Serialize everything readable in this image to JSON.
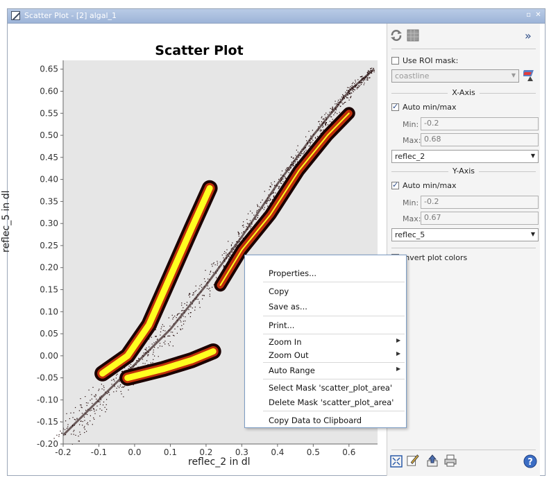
{
  "window": {
    "title": "Scatter Plot - [2] algal_1",
    "buttons": [
      "▫",
      "✕"
    ]
  },
  "plot": {
    "title": "Scatter Plot",
    "xlabel": "reflec_2 in dl",
    "ylabel": "reflec_5 in dl"
  },
  "chart_data": {
    "type": "scatter",
    "title": "Scatter Plot",
    "xlabel": "reflec_2 in dl",
    "ylabel": "reflec_5 in dl",
    "xlim": [
      -0.2,
      0.68
    ],
    "ylim": [
      -0.2,
      0.67
    ],
    "xticks": [
      "-0.2",
      "-0.1",
      "0.0",
      "0.1",
      "0.2",
      "0.3",
      "0.4",
      "0.5",
      "0.6"
    ],
    "yticks": [
      "-0.20",
      "-0.15",
      "-0.10",
      "-0.05",
      "0.00",
      "0.05",
      "0.10",
      "0.15",
      "0.20",
      "0.25",
      "0.30",
      "0.35",
      "0.40",
      "0.45",
      "0.50",
      "0.55",
      "0.60",
      "0.65"
    ],
    "grid": false,
    "density_bands": [
      {
        "points": [
          [
            -0.2,
            -0.18
          ],
          [
            -0.1,
            -0.1
          ],
          [
            0.0,
            -0.02
          ],
          [
            0.1,
            0.06
          ],
          [
            0.2,
            0.16
          ],
          [
            0.3,
            0.27
          ],
          [
            0.4,
            0.39
          ],
          [
            0.5,
            0.5
          ],
          [
            0.6,
            0.6
          ],
          [
            0.67,
            0.65
          ]
        ],
        "density": "sparse"
      },
      {
        "points": [
          [
            -0.09,
            -0.04
          ],
          [
            -0.02,
            0.0
          ],
          [
            0.04,
            0.07
          ],
          [
            0.1,
            0.18
          ],
          [
            0.16,
            0.29
          ],
          [
            0.21,
            0.38
          ]
        ],
        "density": "high"
      },
      {
        "points": [
          [
            -0.02,
            -0.05
          ],
          [
            0.08,
            -0.03
          ],
          [
            0.16,
            -0.01
          ],
          [
            0.22,
            0.01
          ]
        ],
        "density": "high"
      },
      {
        "points": [
          [
            0.24,
            0.16
          ],
          [
            0.3,
            0.24
          ],
          [
            0.38,
            0.32
          ],
          [
            0.46,
            0.42
          ],
          [
            0.54,
            0.5
          ],
          [
            0.6,
            0.55
          ]
        ],
        "density": "medium"
      }
    ]
  },
  "sidebar": {
    "use_roi_label": "Use ROI mask:",
    "roi_value": "coastline",
    "x_axis": {
      "title": "X-Axis",
      "auto_label": "Auto min/max",
      "min_label": "Min:",
      "min_value": "-0.2",
      "max_label": "Max:",
      "max_value": "0.68",
      "band": "reflec_2"
    },
    "y_axis": {
      "title": "Y-Axis",
      "auto_label": "Auto min/max",
      "min_label": "Min:",
      "min_value": "-0.2",
      "max_label": "Max:",
      "max_value": "0.67",
      "band": "reflec_5"
    },
    "invert_label": "Invert plot colors",
    "collapse_icon": "»"
  },
  "context_menu": {
    "items": [
      {
        "label": "Properties...",
        "submenu": false
      },
      {
        "label": "Copy",
        "submenu": false
      },
      {
        "label": "Save as...",
        "submenu": false
      },
      {
        "label": "Print...",
        "submenu": false
      },
      {
        "label": "Zoom In",
        "submenu": true
      },
      {
        "label": "Zoom Out",
        "submenu": true
      },
      {
        "label": "Auto Range",
        "submenu": true
      },
      {
        "label": "Select Mask 'scatter_plot_area'",
        "submenu": false
      },
      {
        "label": "Delete Mask 'scatter_plot_area'",
        "submenu": false
      },
      {
        "label": "Copy Data to Clipboard",
        "submenu": false
      }
    ]
  },
  "icons": {
    "refresh": "refresh-icon",
    "table": "table-icon",
    "zoom_all": "zoom-all-icon",
    "edit": "edit-icon",
    "export": "export-icon",
    "print": "print-icon",
    "help": "help-icon",
    "roi_tool": "roi-mask-icon"
  },
  "colors": {
    "plot_bg": "#e6e6e6",
    "density_low": "#1a0000",
    "density_mid": "#c0300b",
    "density_high": "#ffff20",
    "menu_border": "#7c9cc4"
  }
}
